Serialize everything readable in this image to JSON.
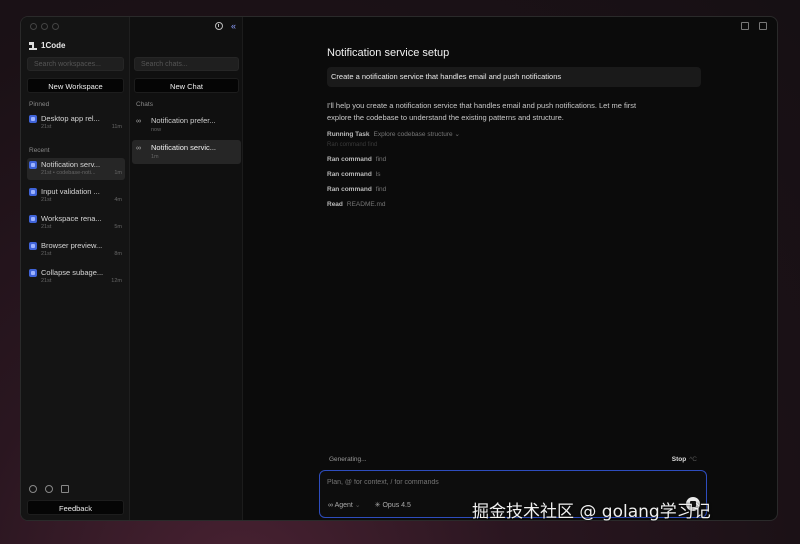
{
  "app": {
    "name": "1Code"
  },
  "sidebar": {
    "search_placeholder": "Search workspaces...",
    "new_workspace_label": "New Workspace",
    "pinned_label": "Pinned",
    "pinned": [
      {
        "title": "Desktop app rel...",
        "sub": "21st",
        "time": "11m"
      }
    ],
    "recent_label": "Recent",
    "recent": [
      {
        "title": "Notification serv...",
        "sub": "21st • codebase-noti...",
        "time": "1m"
      },
      {
        "title": "Input validation ...",
        "sub": "21st",
        "time": "4m"
      },
      {
        "title": "Workspace rena...",
        "sub": "21st",
        "time": "5m"
      },
      {
        "title": "Browser preview...",
        "sub": "21st",
        "time": "8m"
      },
      {
        "title": "Collapse subage...",
        "sub": "21st",
        "time": "12m"
      }
    ],
    "feedback_label": "Feedback"
  },
  "chats": {
    "search_placeholder": "Search chats...",
    "new_chat_label": "New Chat",
    "section_label": "Chats",
    "items": [
      {
        "title": "Notification prefer...",
        "sub": "now"
      },
      {
        "title": "Notification servic...",
        "sub": "1m"
      }
    ]
  },
  "main": {
    "title": "Notification service setup",
    "prompt": "Create a notification service that handles email and push notifications",
    "reply": "I'll help you create a notification service that handles email and push notifications. Let me first explore the codebase to understand the existing patterns and structure.",
    "running_task_label": "Running Task",
    "running_task_value": "Explore codebase structure",
    "faded_line": "Ran command  find",
    "tools": [
      {
        "label": "Ran command",
        "value": "find"
      },
      {
        "label": "Ran command",
        "value": "ls"
      },
      {
        "label": "Ran command",
        "value": "find"
      },
      {
        "label": "Read",
        "value": "README.md"
      }
    ],
    "generating_label": "Generating...",
    "stop_label": "Stop",
    "stop_shortcut": "^C",
    "composer_placeholder": "Plan, @ for context, / for commands",
    "agent_label": "Agent",
    "model_label": "Opus 4.5"
  },
  "watermark": "掘金技术社区 @ golang学习记",
  "colors": {
    "accent": "#3f63d8",
    "composer_border": "#2e4dbe"
  }
}
